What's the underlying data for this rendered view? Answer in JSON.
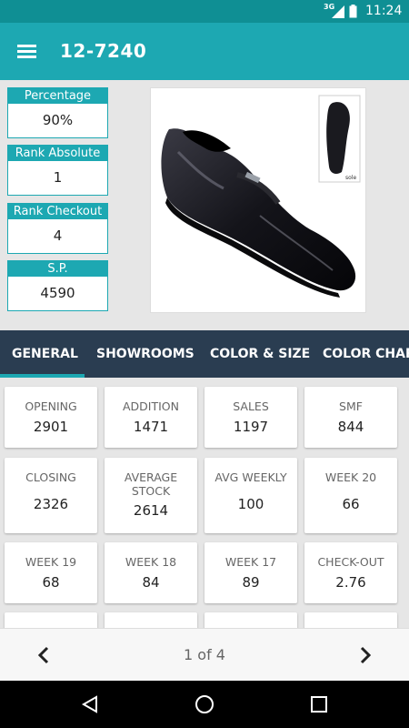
{
  "status_bar": {
    "network": "3G",
    "time": "11:24"
  },
  "app_bar": {
    "title": "12-7240"
  },
  "stats": [
    {
      "label": "Percentage",
      "value": "90%"
    },
    {
      "label": "Rank Absolute",
      "value": "1"
    },
    {
      "label": "Rank Checkout",
      "value": "4"
    },
    {
      "label": "S.P.",
      "value": "4590"
    }
  ],
  "product_image": {
    "caption": "sole"
  },
  "tabs": [
    {
      "label": "GENERAL",
      "active": true
    },
    {
      "label": "SHOWROOMS"
    },
    {
      "label": "COLOR & SIZE"
    },
    {
      "label": "COLOR CHART"
    }
  ],
  "cards": [
    {
      "label": "OPENING",
      "value": "2901"
    },
    {
      "label": "ADDITION",
      "value": "1471"
    },
    {
      "label": "SALES",
      "value": "1197"
    },
    {
      "label": "SMF",
      "value": "844"
    },
    {
      "label": "CLOSING",
      "value": "2326"
    },
    {
      "label": "AVERAGE\nSTOCK",
      "value": "2614"
    },
    {
      "label": "AVG WEEKLY",
      "value": "100"
    },
    {
      "label": "WEEK 20",
      "value": "66"
    },
    {
      "label": "WEEK 19",
      "value": "68"
    },
    {
      "label": "WEEK 18",
      "value": "84"
    },
    {
      "label": "WEEK 17",
      "value": "89"
    },
    {
      "label": "CHECK-OUT",
      "value": "2.76"
    }
  ],
  "pager": {
    "text": "1 of 4"
  },
  "colors": {
    "primary": "#1da8b2",
    "status_bar": "#0f8f94",
    "tab_bar": "#2a3d51"
  }
}
